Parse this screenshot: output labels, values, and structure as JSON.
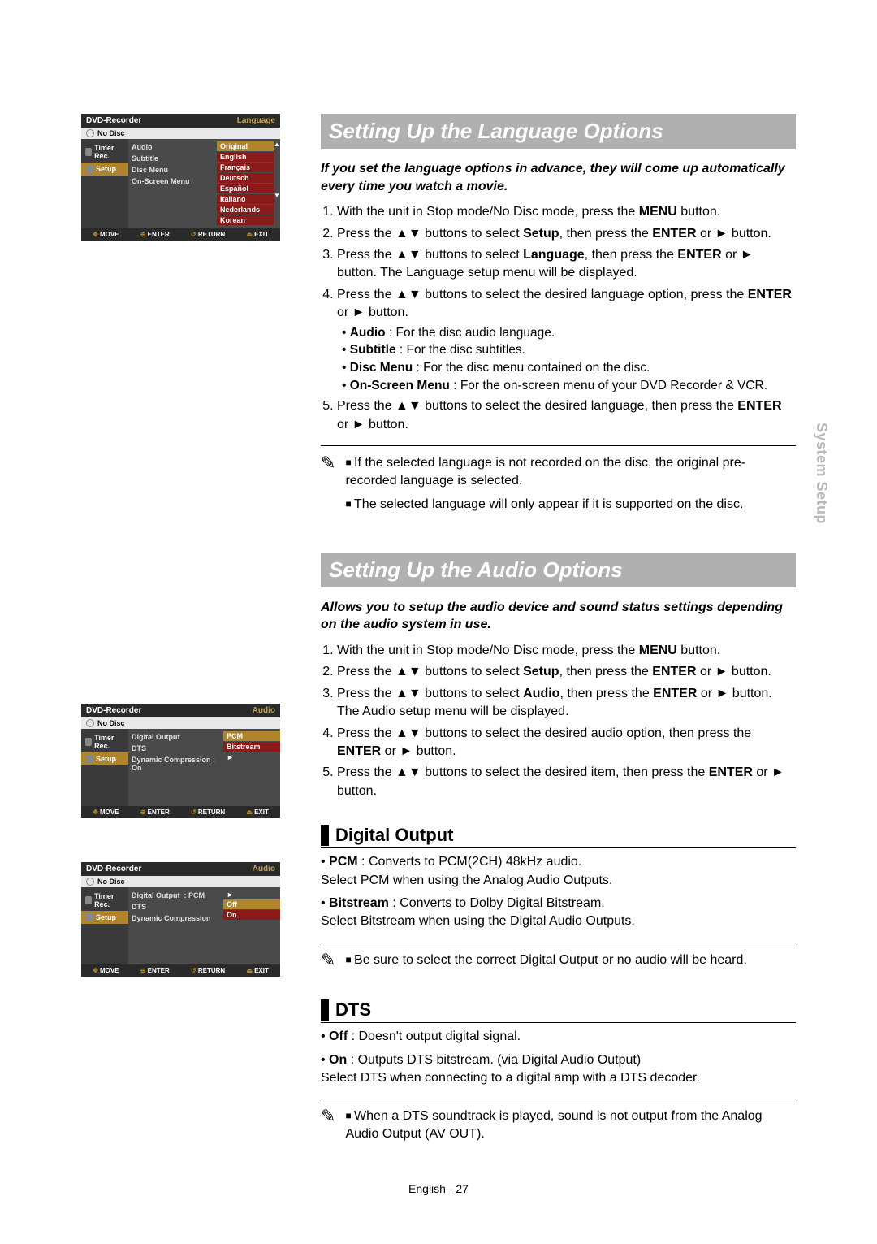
{
  "sideTab": "System Setup",
  "osd_lang": {
    "title": "DVD-Recorder",
    "category": "Language",
    "noDisc": "No Disc",
    "sideItems": [
      "Timer Rec.",
      "Setup"
    ],
    "menuItems": [
      "Audio",
      "Subtitle",
      "Disc Menu",
      "On-Screen Menu"
    ],
    "options": [
      "Original",
      "English",
      "Français",
      "Deutsch",
      "Español",
      "Italiano",
      "Nederlands",
      "Korean"
    ],
    "footer": {
      "move": "MOVE",
      "enter": "ENTER",
      "return": "RETURN",
      "exit": "EXIT"
    }
  },
  "osd_audio1": {
    "title": "DVD-Recorder",
    "category": "Audio",
    "noDisc": "No Disc",
    "sideItems": [
      "Timer Rec.",
      "Setup"
    ],
    "rows": [
      {
        "label": "Digital Output",
        "val": "PCM",
        "box": true,
        "sel": true
      },
      {
        "label": "DTS",
        "val": "Bitstream",
        "box": true
      },
      {
        "label": "Dynamic Compression :",
        "val": "On",
        "box": false,
        "arrow": true
      }
    ],
    "footer": {
      "move": "MOVE",
      "enter": "ENTER",
      "return": "RETURN",
      "exit": "EXIT"
    }
  },
  "osd_audio2": {
    "title": "DVD-Recorder",
    "category": "Audio",
    "noDisc": "No Disc",
    "sideItems": [
      "Timer Rec.",
      "Setup"
    ],
    "rows": [
      {
        "label": "Digital Output",
        "val": ": PCM",
        "box": false,
        "arrow": true
      },
      {
        "label": "DTS",
        "val": "Off",
        "box": true,
        "sel": true
      },
      {
        "label": "Dynamic Compression",
        "val": "On",
        "box": true
      }
    ],
    "footer": {
      "move": "MOVE",
      "enter": "ENTER",
      "return": "RETURN",
      "exit": "EXIT"
    }
  },
  "lang": {
    "heading": "Setting Up the Language Options",
    "intro": "If you set the language options in advance, they will come up automatically every time you watch a movie.",
    "steps": [
      "With the unit in Stop mode/No Disc mode, press the <b>MENU</b> button.",
      "Press the ▲▼ buttons to select <b>Setup</b>, then press the <b>ENTER</b> or ► button.",
      "Press the ▲▼ buttons to select <b>Language</b>, then press the <b>ENTER</b> or ► button. The Language setup menu will be displayed.",
      "Press the ▲▼ buttons to select the desired language option, press the <b>ENTER</b> or ► button.",
      "Press the ▲▼ buttons to select the desired language, then press the <b>ENTER</b> or ► button."
    ],
    "subList": [
      "<b>Audio</b> : For the disc audio language.",
      "<b>Subtitle</b> : For the disc subtitles.",
      "<b>Disc Menu</b> : For the disc menu contained on the disc.",
      "<b>On-Screen Menu</b> : For the on-screen menu of your DVD Recorder & VCR."
    ],
    "notes": [
      "If the selected language is not recorded on the disc, the original pre-recorded language is selected.",
      "The selected language will only appear if it is supported on the disc."
    ]
  },
  "audio": {
    "heading": "Setting Up the Audio Options",
    "intro": "Allows you to setup the audio device and sound status settings depending on the audio system in use.",
    "steps": [
      "With the unit in Stop mode/No Disc mode, press the <b>MENU</b> button.",
      "Press the ▲▼ buttons to select <b>Setup</b>, then press the <b>ENTER</b> or ► button.",
      "Press the ▲▼ buttons to select <b>Audio</b>, then press the <b>ENTER</b> or ► button. The Audio setup menu will be displayed.",
      "Press the ▲▼ buttons to select the desired audio option, then press the <b>ENTER</b> or ► button.",
      "Press the ▲▼ buttons to select the desired item, then press the <b>ENTER</b> or ► button."
    ]
  },
  "digital": {
    "heading": "Digital Output",
    "bullets": [
      "<b>PCM</b> : Converts to PCM(2CH) 48kHz audio.<br>Select PCM when using the Analog Audio Outputs.",
      "<b>Bitstream</b> : Converts to Dolby Digital Bitstream.<br>Select Bitstream when using the Digital Audio Outputs."
    ],
    "notes": [
      "Be sure to select the correct Digital Output or no audio will be heard."
    ]
  },
  "dts": {
    "heading": "DTS",
    "bullets": [
      "<b>Off</b> : Doesn't output digital signal.",
      "<b>On</b> : Outputs DTS bitstream. (via Digital Audio Output)<br>Select DTS when connecting to a digital amp with a DTS decoder."
    ],
    "notes": [
      "When a DTS soundtrack is played, sound is not output from the Analog Audio Output (AV OUT)."
    ]
  },
  "footer": "English - 27"
}
